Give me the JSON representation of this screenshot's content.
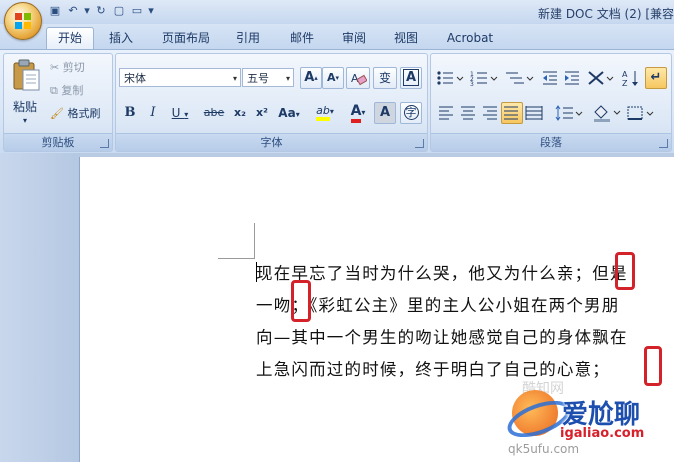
{
  "window": {
    "title": "新建 DOC 文档 (2) [兼容"
  },
  "tabs": [
    {
      "label": "开始",
      "active": true
    },
    {
      "label": "插入"
    },
    {
      "label": "页面布局"
    },
    {
      "label": "引用"
    },
    {
      "label": "邮件"
    },
    {
      "label": "审阅"
    },
    {
      "label": "视图"
    },
    {
      "label": "Acrobat"
    }
  ],
  "clipboard": {
    "group_label": "剪贴板",
    "paste": "粘贴",
    "cut": "剪切",
    "copy": "复制",
    "format_painter": "格式刷"
  },
  "font": {
    "group_label": "字体",
    "font_name": "宋体",
    "font_size": "五号",
    "grow_label": "A",
    "shrink_label": "A",
    "phonetic_label": "变",
    "border_label": "A",
    "bold": "B",
    "italic": "I",
    "underline": "U",
    "strike": "abe",
    "subscript": "x₂",
    "superscript": "x²",
    "case": "Aa",
    "highlight": "ab",
    "font_color": "A",
    "shade": "A",
    "enclose": "字"
  },
  "paragraph": {
    "group_label": "段落"
  },
  "document": {
    "lines": [
      "现在早忘了当时为什么哭，他又为什么亲",
      "一吻；《彩虹公主》里的主人公小姐在两个男朋",
      "向—其中一个男生的吻让她感觉自己的身体飘在",
      "上急闪而过的时候，终于明白了自己的心意；"
    ],
    "line1_tail": "；但是"
  },
  "watermark": {
    "brand": "爱尬聊",
    "url": "igaliao.com",
    "url2": "qk5ufu.com",
    "faint": "酷知网"
  },
  "colors": {
    "accent": "#d3222a",
    "ribbon": "#dbe7f6",
    "tab_text": "#1d3a66"
  }
}
